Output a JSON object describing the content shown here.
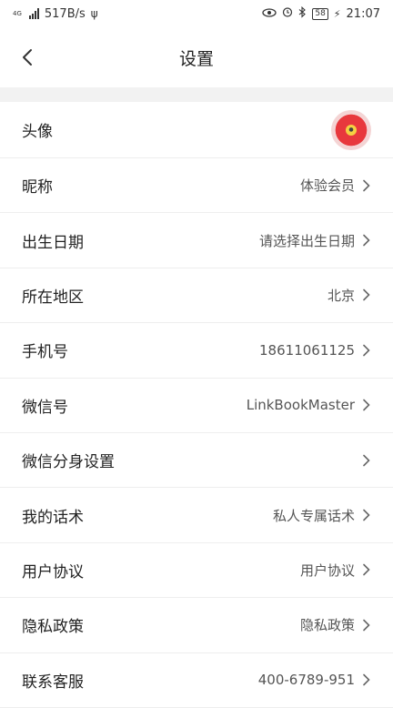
{
  "statusbar": {
    "network": "4G",
    "speed": "517B/s",
    "battery": "58",
    "time": "21:07"
  },
  "header": {
    "title": "设置"
  },
  "rows": [
    {
      "label": "头像",
      "value": ""
    },
    {
      "label": "昵称",
      "value": "体验会员"
    },
    {
      "label": "出生日期",
      "value": "请选择出生日期"
    },
    {
      "label": "所在地区",
      "value": "北京"
    },
    {
      "label": "手机号",
      "value": "18611061125"
    },
    {
      "label": "微信号",
      "value": "LinkBookMaster"
    },
    {
      "label": "微信分身设置",
      "value": ""
    },
    {
      "label": "我的话术",
      "value": "私人专属话术"
    },
    {
      "label": "用户协议",
      "value": "用户协议"
    },
    {
      "label": "隐私政策",
      "value": "隐私政策"
    },
    {
      "label": "联系客服",
      "value": "400-6789-951"
    }
  ],
  "icons": {
    "back": "chevron-left-icon",
    "row_arrow": "chevron-right-icon",
    "avatar": "red-mascot-avatar"
  },
  "colors": {
    "separator_bg": "#f2f2f2",
    "divider": "#eeeeee",
    "avatar_red": "#e8383d"
  }
}
